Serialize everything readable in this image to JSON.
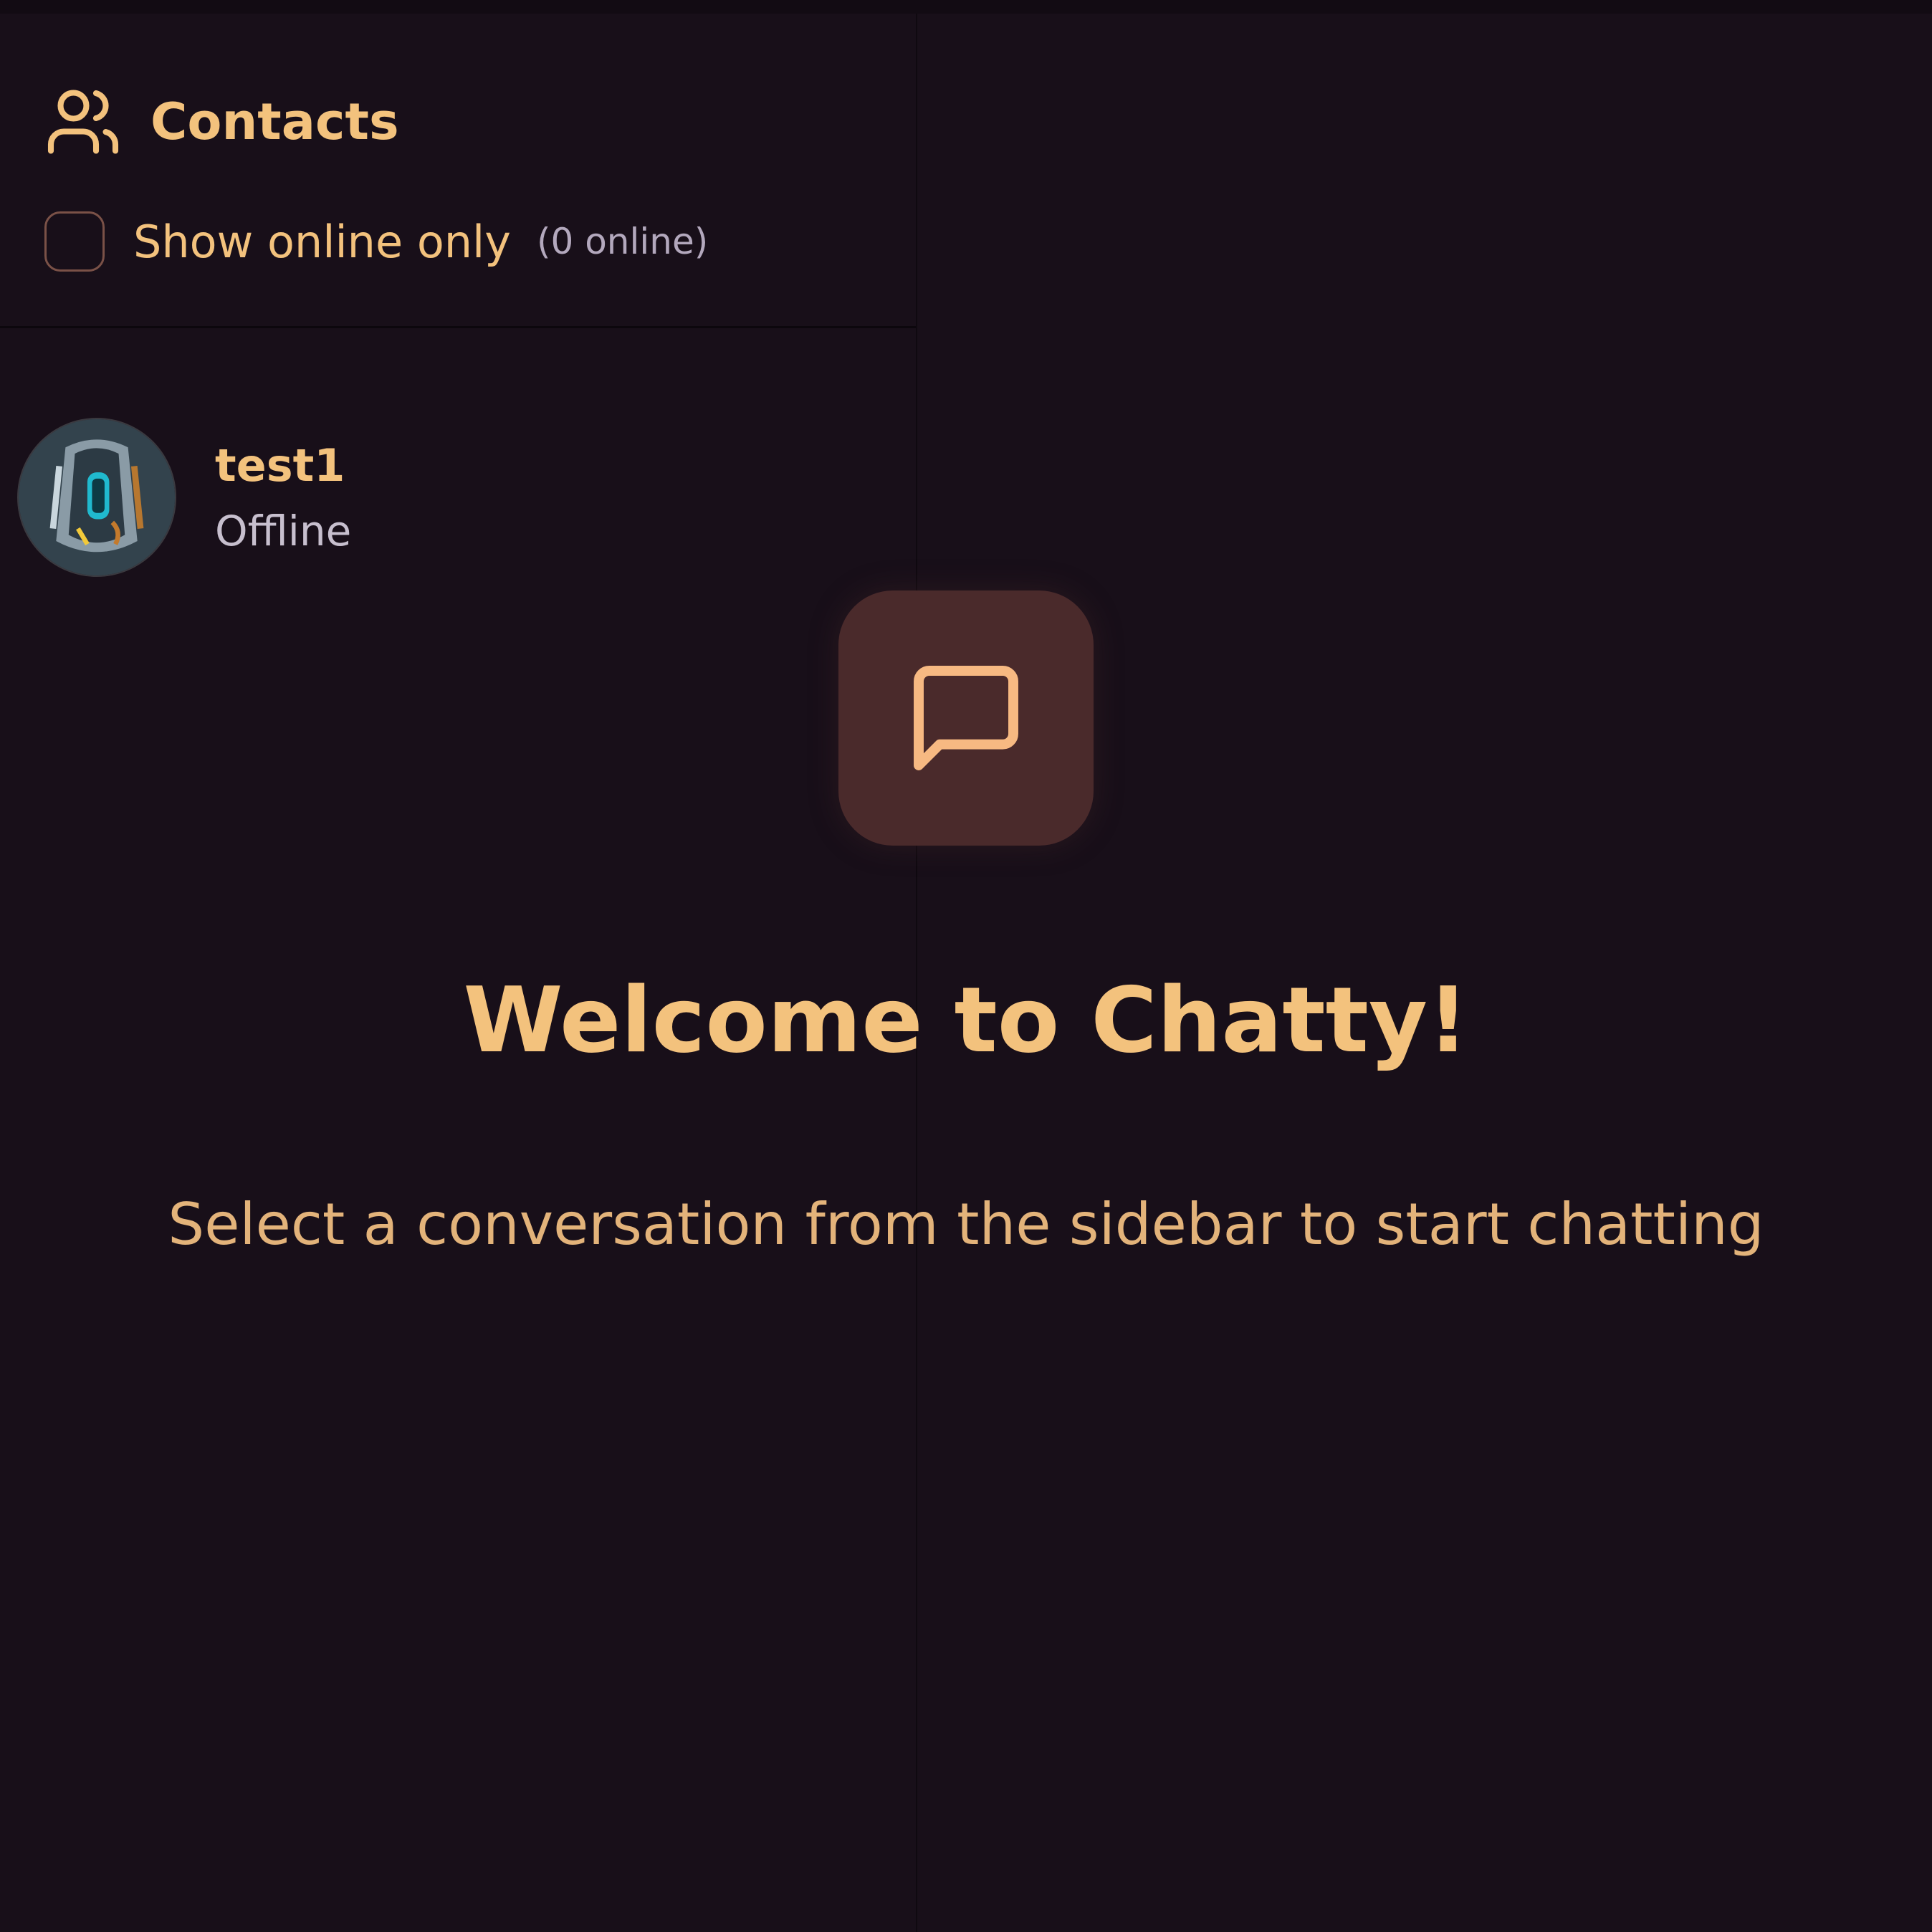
{
  "sidebar": {
    "title": "Contacts",
    "title_icon": "users-icon",
    "filter": {
      "label": "Show online only",
      "online_count": "(0 online)",
      "checked": false
    },
    "contacts": [
      {
        "name": "test1",
        "status": "Offline",
        "avatar": "avatar-image"
      }
    ]
  },
  "main": {
    "icon": "message-square-icon",
    "title": "Welcome to Chatty!",
    "subtitle": "Select a conversation from the sidebar to start chatting"
  },
  "colors": {
    "background": "#180f19",
    "accent": "#f3c27d",
    "muted_text": "#c7bfce",
    "icon_box": "#4a2a2b",
    "icon_stroke": "#f7b982"
  }
}
